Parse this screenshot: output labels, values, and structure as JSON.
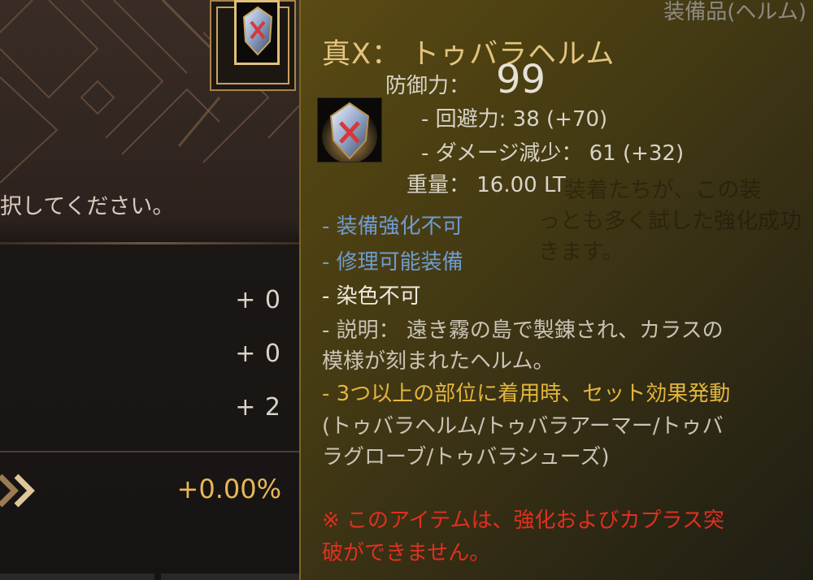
{
  "enhance_panel": {
    "instruction": "択してください。",
    "stats": [
      "+ 0",
      "+ 0",
      "+ 2"
    ],
    "success_rate": "+0.00%"
  },
  "tooltip": {
    "category": "装備品(ヘルム)",
    "item_name": "真X： トゥバラヘルム",
    "defense_label": "防御力：",
    "defense_value": "99",
    "evasion_line": "- 回避力: 38 (+70)",
    "dr_line": "- ダメージ減少：  61 (+32)",
    "weight_line": "重量：  16.00 LT",
    "flag_no_enhance": "- 装備強化不可",
    "flag_repairable": "- 修理可能装備",
    "flag_no_dye": "- 染色不可",
    "description_1": "- 説明： 遠き霧の島で製錬され、カラスの",
    "description_2": "模様が刻まれたヘルム。",
    "set_effect": "- 3つ以上の部位に着用時、セット効果発動",
    "set_items_1": "(トゥバラヘルム/トゥバラアーマー/トゥバ",
    "set_items_2": "ラグローブ/トゥバラシューズ)",
    "warning_1": "※ このアイテムは、強化およびカプラス突",
    "warning_2": "破ができません。",
    "background_text": [
      "装着たちが、この装",
      "っとも多く試した強化成功",
      "きます。"
    ]
  },
  "icons": {
    "item": "helmet-icon",
    "chevron": "double-chevron-right-icon"
  },
  "colors": {
    "name_gold": "#e3c47e",
    "info_blue": "#6f9bd0",
    "set_gold": "#e3b53c",
    "warning_red": "#e03020",
    "rate_orange": "#e9b659"
  }
}
